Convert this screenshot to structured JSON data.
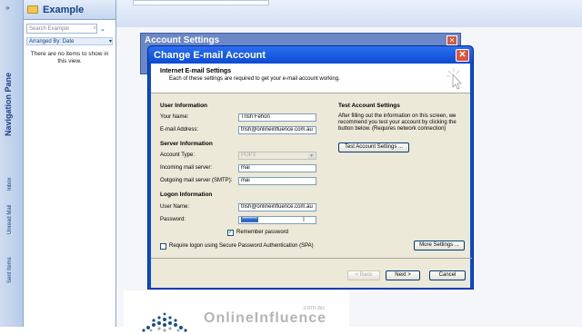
{
  "outlook": {
    "nav_title": "Navigation Pane",
    "nav_items": [
      "Inbox",
      "Unread Mail",
      "Sent Items"
    ],
    "folder_title": "Example",
    "search_placeholder": "Search Example",
    "arranged_by": "Arranged By: Date",
    "empty_message": "There are no items to show in this view."
  },
  "account_settings": {
    "title": "Account Settings"
  },
  "dialog": {
    "title": "Change E-mail Account",
    "header_title": "Internet E-mail Settings",
    "header_sub": "Each of these settings are required to get your e-mail account working.",
    "user_info_title": "User Information",
    "your_name_label": "Your Name:",
    "your_name_value": "Trish Fehon",
    "email_label": "E-mail Address:",
    "email_value": "trish@onlineinfluence.com.au",
    "server_info_title": "Server Information",
    "account_type_label": "Account Type:",
    "account_type_value": "POP3",
    "incoming_label": "Incoming mail server:",
    "incoming_value": "mai",
    "outgoing_label": "Outgoing mail server (SMTP):",
    "outgoing_value": "mai",
    "logon_info_title": "Logon Information",
    "username_label": "User Name:",
    "username_value": "trish@onlineinfluence.com.au",
    "password_label": "Password:",
    "password_value": "*********",
    "remember_label": "Remember password",
    "spa_label": "Require logon using Secure Password Authentication (SPA)",
    "test_title": "Test Account Settings",
    "test_desc": "After filling out the information on this screen, we recommend you test your account by clicking the button below. (Requires network connection)",
    "test_button": "Test Account Settings ...",
    "more_settings": "More Settings ...",
    "back_button": "< Back",
    "next_button": "Next >",
    "cancel_button": "Cancel"
  },
  "brand": {
    "name": "OnlineInfluence",
    "domain": ".com.au"
  }
}
